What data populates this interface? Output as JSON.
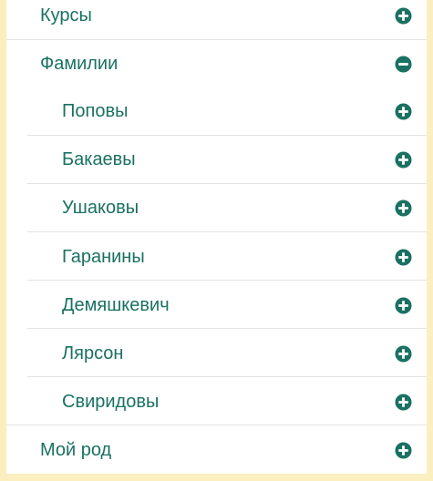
{
  "menu": {
    "items": [
      {
        "label": "Курсы",
        "state": "collapsed"
      },
      {
        "label": "Фамилии",
        "state": "expanded",
        "children": [
          {
            "label": "Поповы",
            "state": "collapsed"
          },
          {
            "label": "Бакаевы",
            "state": "collapsed"
          },
          {
            "label": "Ушаковы",
            "state": "collapsed"
          },
          {
            "label": "Гаранины",
            "state": "collapsed"
          },
          {
            "label": "Демяшкевич",
            "state": "collapsed"
          },
          {
            "label": "Лярсон",
            "state": "collapsed"
          },
          {
            "label": "Свиридовы",
            "state": "collapsed"
          }
        ]
      },
      {
        "label": "Мой род",
        "state": "collapsed"
      }
    ]
  },
  "colors": {
    "background": "#fbefc0",
    "panel": "#ffffff",
    "text": "#1a7162",
    "icon": "#1a7162",
    "divider": "#e3e3e3"
  },
  "icons": {
    "collapsed": "plus-circle-icon",
    "expanded": "minus-circle-icon"
  }
}
